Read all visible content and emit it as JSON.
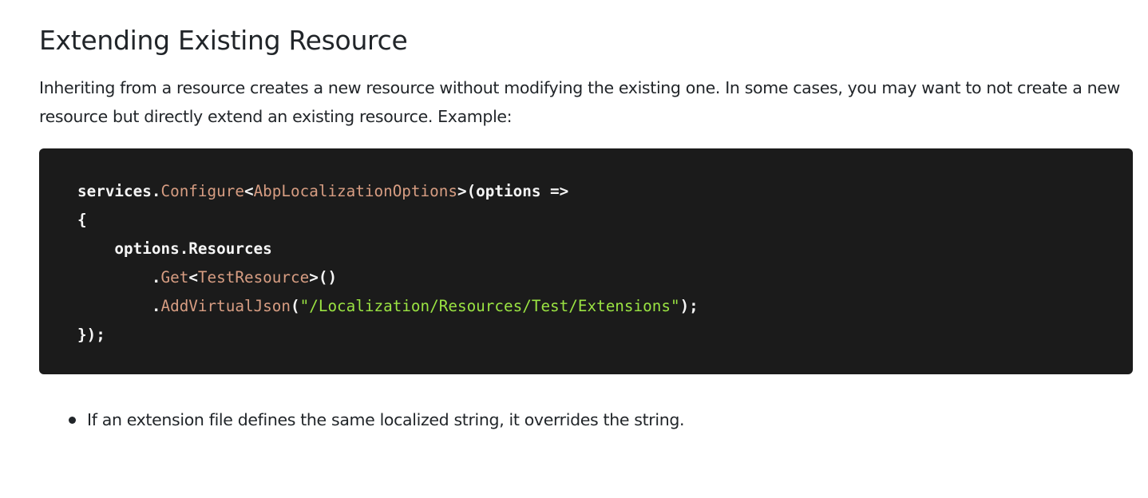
{
  "heading": "Extending Existing Resource",
  "intro": "Inheriting from a resource creates a new resource without modifying the existing one. In some cases, you may want to not create a new resource but directly extend an existing resource. Example:",
  "code": {
    "lines": [
      [
        {
          "t": "services.",
          "k": "plain"
        },
        {
          "t": "Configure",
          "k": "method"
        },
        {
          "t": "<",
          "k": "plain"
        },
        {
          "t": "AbpLocalizationOptions",
          "k": "type"
        },
        {
          "t": ">(options =>",
          "k": "plain"
        }
      ],
      [
        {
          "t": "{",
          "k": "plain"
        }
      ],
      [
        {
          "t": "    options.Resources",
          "k": "plain"
        }
      ],
      [
        {
          "t": "        .",
          "k": "plain"
        },
        {
          "t": "Get",
          "k": "method"
        },
        {
          "t": "<",
          "k": "plain"
        },
        {
          "t": "TestResource",
          "k": "type"
        },
        {
          "t": ">()",
          "k": "plain"
        }
      ],
      [
        {
          "t": "        .",
          "k": "plain"
        },
        {
          "t": "AddVirtualJson",
          "k": "method"
        },
        {
          "t": "(",
          "k": "plain"
        },
        {
          "t": "\"/Localization/Resources/Test/Extensions\"",
          "k": "string"
        },
        {
          "t": ");",
          "k": "plain"
        }
      ],
      [
        {
          "t": "});",
          "k": "plain"
        }
      ]
    ]
  },
  "notes": [
    "If an extension file defines the same localized string, it overrides the string."
  ]
}
